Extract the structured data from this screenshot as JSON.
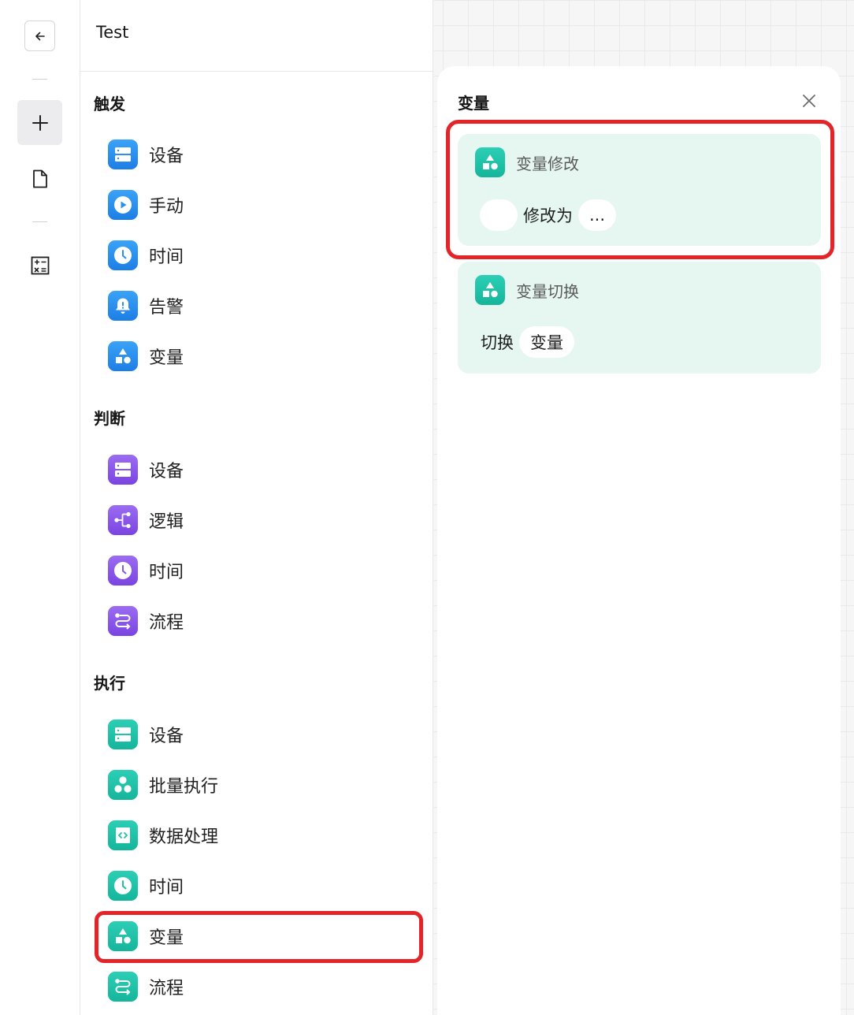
{
  "rail": {
    "buttons": [
      {
        "name": "back-button",
        "icon": "arrow-left-icon"
      },
      {
        "name": "add-button",
        "icon": "plus-icon"
      },
      {
        "name": "document-button",
        "icon": "document-icon"
      },
      {
        "name": "calculator-button",
        "icon": "calculator-icon"
      }
    ]
  },
  "palette": {
    "title": "Test",
    "sections": [
      {
        "title": "触发",
        "color": "#2a8ff0",
        "items": [
          {
            "label": "设备",
            "icon": "server-icon"
          },
          {
            "label": "手动",
            "icon": "play-icon"
          },
          {
            "label": "时间",
            "icon": "clock-icon"
          },
          {
            "label": "告警",
            "icon": "bell-icon"
          },
          {
            "label": "变量",
            "icon": "shapes-icon"
          }
        ]
      },
      {
        "title": "判断",
        "color": "#8656e9",
        "items": [
          {
            "label": "设备",
            "icon": "server-icon"
          },
          {
            "label": "逻辑",
            "icon": "branch-icon"
          },
          {
            "label": "时间",
            "icon": "clock-icon"
          },
          {
            "label": "流程",
            "icon": "flow-icon"
          }
        ]
      },
      {
        "title": "执行",
        "color": "#1fc2a7",
        "items": [
          {
            "label": "设备",
            "icon": "server-icon"
          },
          {
            "label": "批量执行",
            "icon": "batch-icon"
          },
          {
            "label": "数据处理",
            "icon": "code-icon"
          },
          {
            "label": "时间",
            "icon": "clock-icon"
          },
          {
            "label": "变量",
            "icon": "shapes-icon"
          },
          {
            "label": "流程",
            "icon": "flow-icon"
          }
        ]
      }
    ]
  },
  "panel": {
    "title": "变量",
    "close_icon": "close-icon",
    "cards": [
      {
        "name": "变量修改",
        "icon": "shapes-icon",
        "body_text": "修改为",
        "target_value": "",
        "value_pill": "..."
      },
      {
        "name": "变量切换",
        "icon": "shapes-icon",
        "body_text": "切换",
        "variable_pill": "变量"
      }
    ]
  },
  "highlight_color": "#e3252a"
}
